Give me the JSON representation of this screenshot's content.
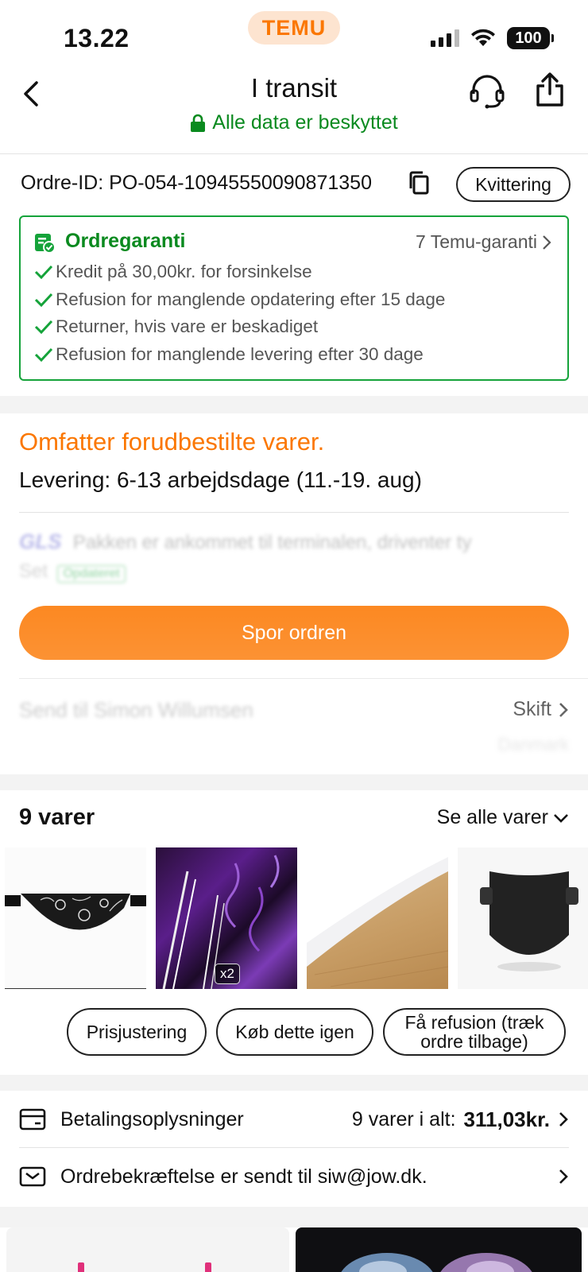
{
  "status_bar": {
    "time": "13.22",
    "brand": "TEMU",
    "battery": "100"
  },
  "header": {
    "title": "I transit",
    "secure_text": "Alle data er beskyttet"
  },
  "order": {
    "id_label": "Ordre-ID: PO-054-10945550090871350",
    "receipt_label": "Kvittering"
  },
  "guarantee": {
    "title": "Ordregaranti",
    "link": "7 Temu-garanti",
    "items": [
      "Kredit på 30,00kr. for forsinkelse",
      "Refusion for manglende opdatering efter 15 dage",
      "Returner, hvis vare er beskadiget",
      "Refusion for manglende levering efter 30 dage"
    ]
  },
  "delivery": {
    "preorder_text": "Omfatter forudbestilte varer.",
    "delivery_text": "Levering: 6-13 arbejdsdage (11.-19. aug)",
    "carrier": "GLS",
    "tracking_text": "Pakken er ankommet til terminalen, driventer ty",
    "tracking_tag": "Opdateret",
    "track_button": "Spor ordren",
    "send_to": "Send til Simon Willumsen",
    "change_label": "Skift",
    "address_country": "Danmark"
  },
  "items": {
    "count_label": "9 varer",
    "see_all_label": "Se alle varer",
    "thumbs": [
      {
        "name": "bandana"
      },
      {
        "name": "purple-wrap",
        "badge": "x2"
      },
      {
        "name": "white-film"
      },
      {
        "name": "black-visor"
      }
    ]
  },
  "actions": {
    "price_adjust": "Prisjustering",
    "buy_again": "Køb dette igen",
    "refund_line1": "Få refusion (træk",
    "refund_line2": "ordre tilbage)"
  },
  "payment": {
    "label": "Betalingsoplysninger",
    "summary": "9 varer i alt:",
    "total": "311,03kr."
  },
  "confirmation": {
    "text": "Ordrebekræftelse er sendt til siw@jow.dk."
  },
  "colors": {
    "accent": "#fb7701",
    "green": "#0a8a1f",
    "border_green": "#15a33a"
  }
}
